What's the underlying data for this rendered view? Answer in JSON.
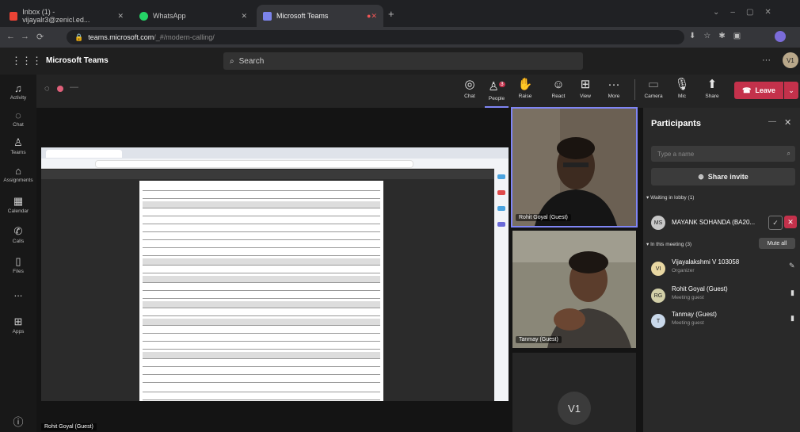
{
  "browser": {
    "tabs": [
      {
        "label": "Inbox (1) - vijayalr3@zenicl.ed...",
        "icon": "gmail-icon",
        "color": "#ea4335"
      },
      {
        "label": "WhatsApp",
        "icon": "whatsapp-icon",
        "color": "#25d366"
      },
      {
        "label": "Microsoft Teams",
        "icon": "teams-icon",
        "color": "#7b83eb"
      }
    ],
    "url_host": "teams.microsoft.com",
    "url_path": "/_#/modern-calling/"
  },
  "teams": {
    "app_title": "Microsoft Teams",
    "search_placeholder": "Search",
    "user_initials": "V1",
    "rail": [
      {
        "label": "Activity",
        "icon": "bell-icon"
      },
      {
        "label": "Chat",
        "icon": "chat-icon"
      },
      {
        "label": "Teams",
        "icon": "teams-icon"
      },
      {
        "label": "Assignments",
        "icon": "assignments-icon"
      },
      {
        "label": "Calendar",
        "icon": "calendar-icon"
      },
      {
        "label": "Calls",
        "icon": "phone-icon"
      },
      {
        "label": "Files",
        "icon": "files-icon"
      },
      {
        "label": "...",
        "icon": "more-icon"
      },
      {
        "label": "Apps",
        "icon": "apps-icon"
      },
      {
        "label": "?",
        "icon": "help-icon"
      }
    ]
  },
  "meeting": {
    "toolbar": [
      {
        "label": "Chat",
        "icon": "chat-icon"
      },
      {
        "label": "People",
        "icon": "people-icon",
        "badge": "3"
      },
      {
        "label": "Raise",
        "icon": "raise-hand-icon"
      },
      {
        "label": "React",
        "icon": "react-icon"
      },
      {
        "label": "View",
        "icon": "view-icon"
      },
      {
        "label": "More",
        "icon": "more-icon"
      },
      {
        "label": "Camera",
        "icon": "camera-off-icon"
      },
      {
        "label": "Mic",
        "icon": "mic-icon"
      },
      {
        "label": "Share",
        "icon": "share-icon"
      }
    ],
    "leave_label": "Leave",
    "presenter_label": "Rohit Goyal (Guest)",
    "tiles": [
      {
        "name": "Rohit Goyal (Guest)"
      },
      {
        "name": "Tanmay (Guest)"
      }
    ],
    "self_initials": "V1"
  },
  "participants": {
    "title": "Participants",
    "search_placeholder": "Type a name",
    "share_invite": "Share invite",
    "lobby_header": "Waiting in lobby (1)",
    "lobby": [
      {
        "initials": "MS",
        "name": "MAYANK SOHANDA (BA20..."
      }
    ],
    "in_meeting_header": "In this meeting (3)",
    "mute_all": "Mute all",
    "members": [
      {
        "initials": "VI",
        "name": "Vijayalakshmi V 103058",
        "role": "Organizer"
      },
      {
        "initials": "RG",
        "name": "Rohit Goyal (Guest)",
        "role": "Meeting guest"
      },
      {
        "initials": "T",
        "name": "Tanmay (Guest)",
        "role": "Meeting guest"
      }
    ]
  },
  "colors": {
    "accent": "#7f85f5",
    "leave": "#c4314b"
  }
}
